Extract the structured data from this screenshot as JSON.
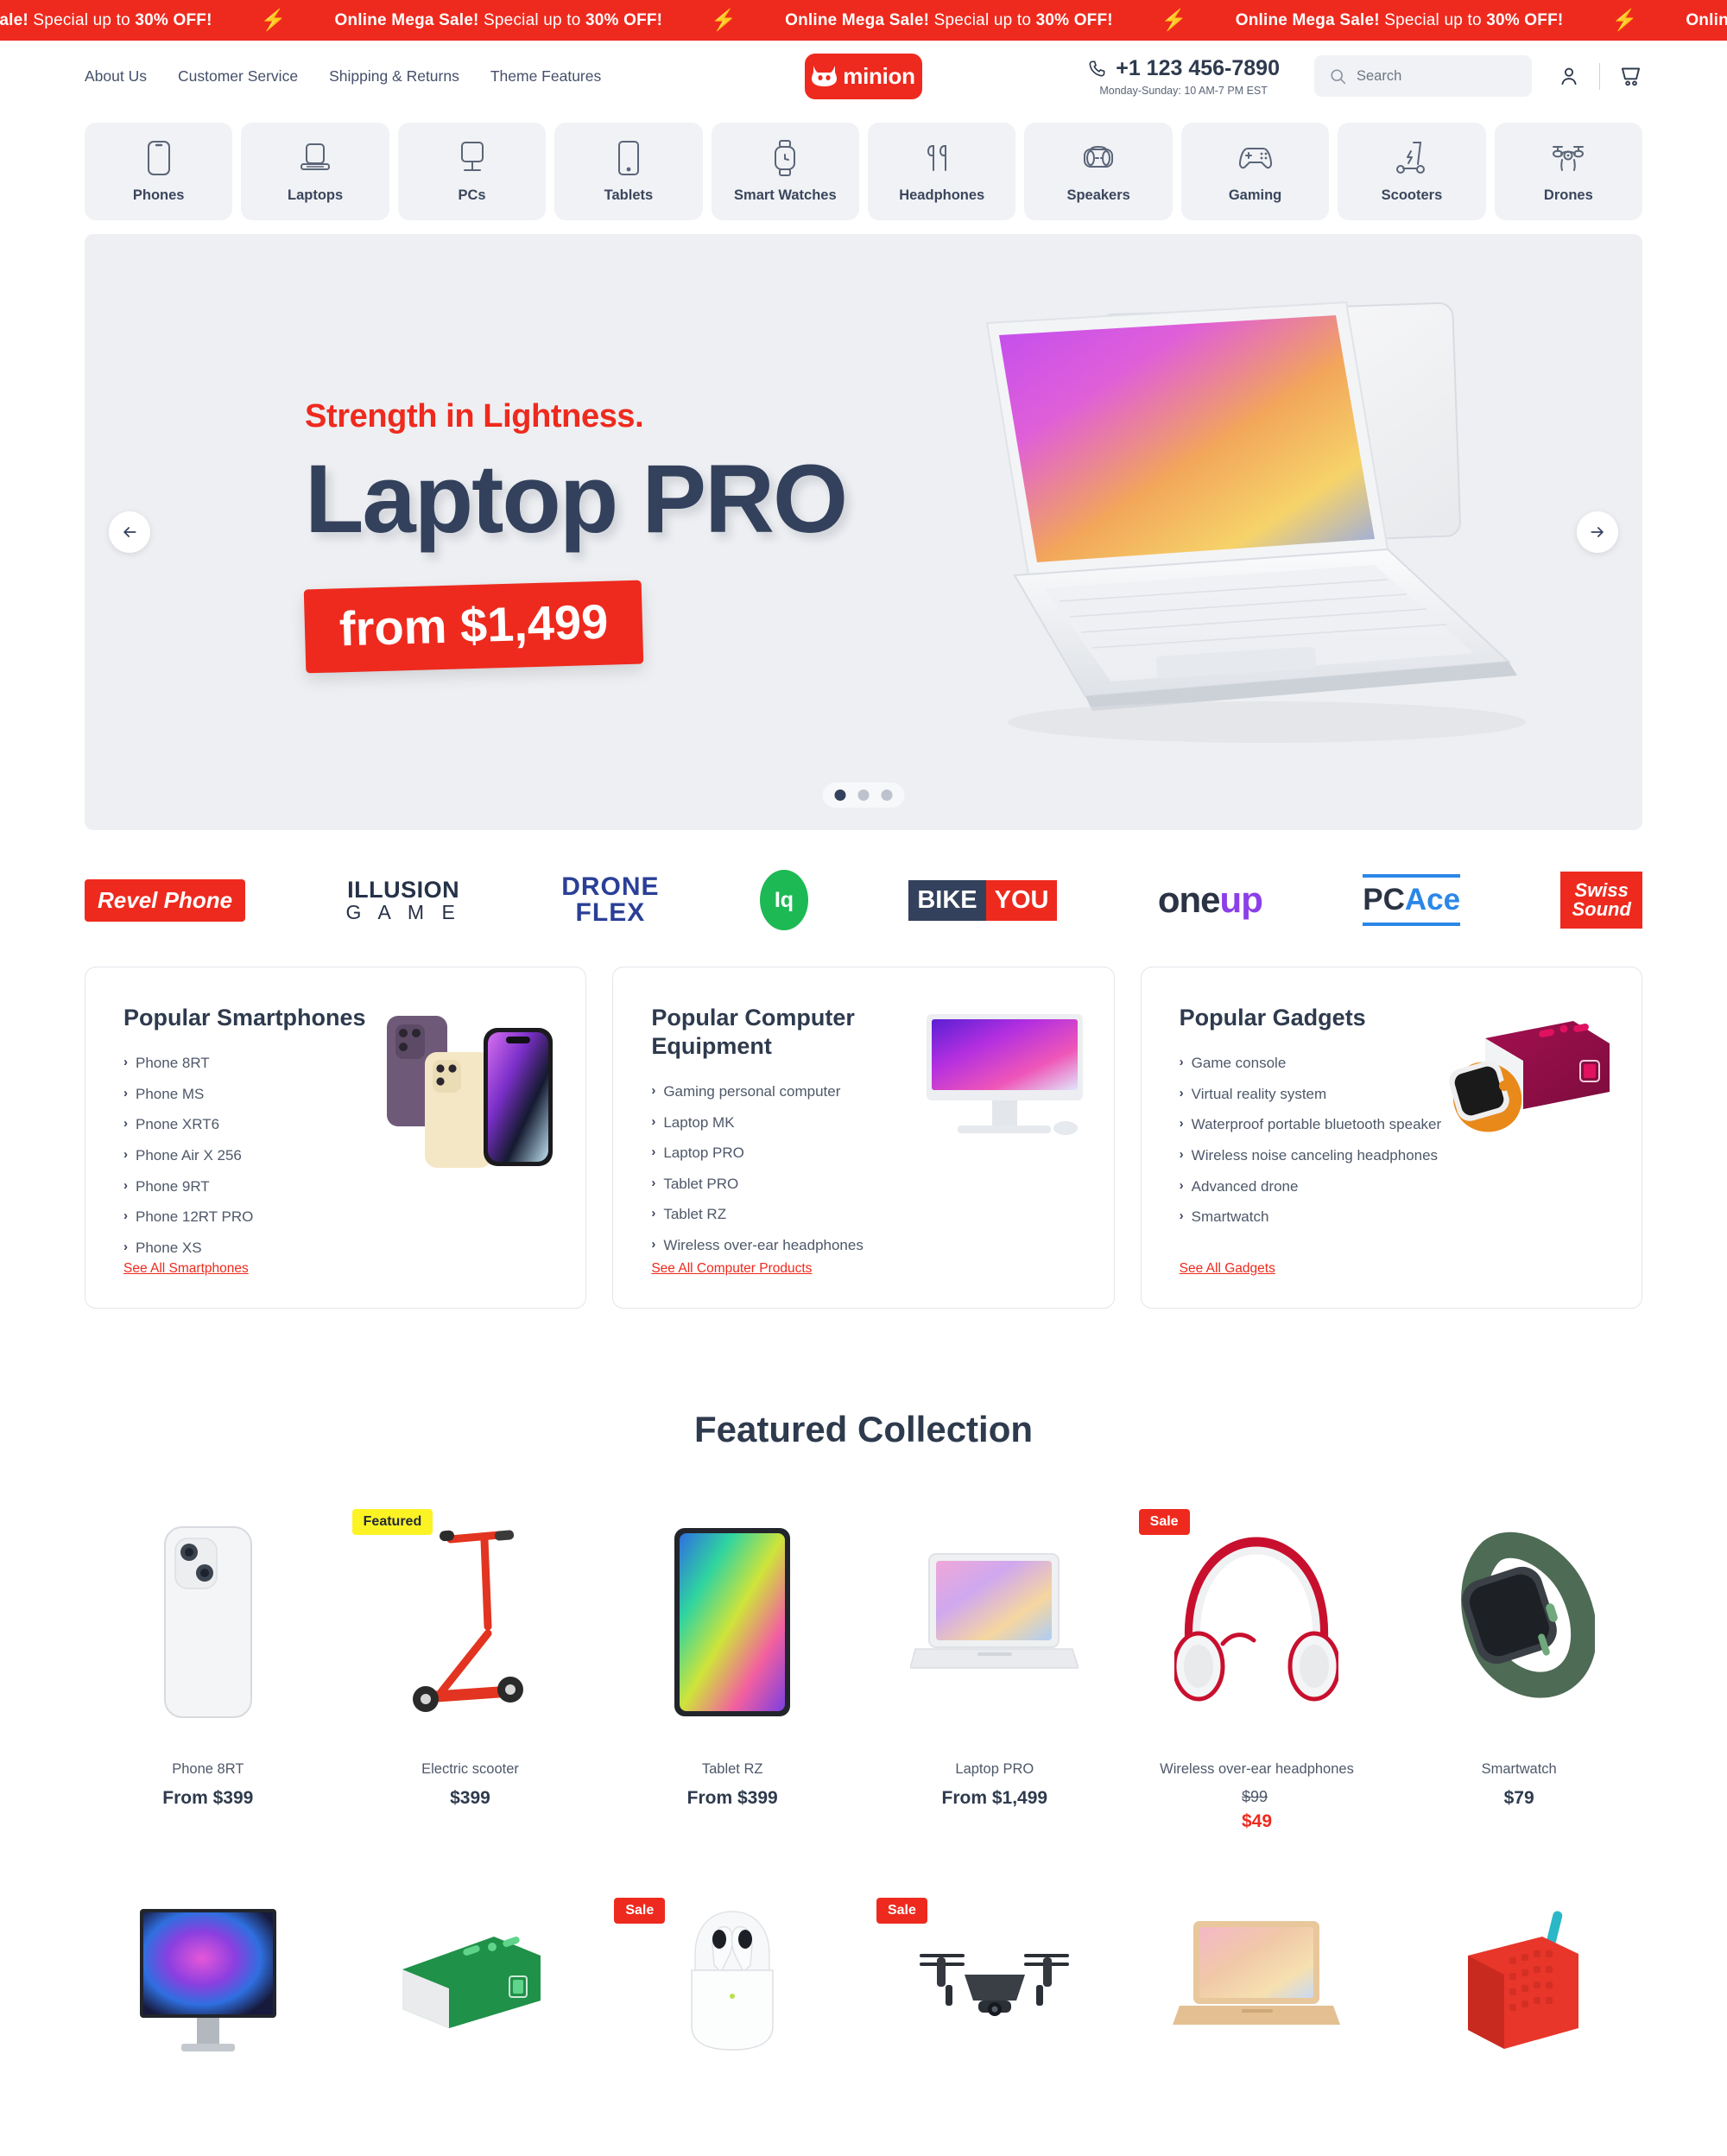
{
  "announcement": {
    "bolt_icon": "lightning-bolt-icon",
    "strong": "Online Mega Sale!",
    "rest": " Special up to ",
    "highlight": "30% OFF!",
    "repeat": 4
  },
  "header": {
    "topnav": [
      {
        "label": "About Us"
      },
      {
        "label": "Customer Service"
      },
      {
        "label": "Shipping & Returns"
      },
      {
        "label": "Theme Features"
      }
    ],
    "logo": {
      "wordmark": "minion",
      "mark_icon": "cow-head-icon",
      "bg": "#ee2a1e"
    },
    "phone": {
      "number": "+1 123 456-7890",
      "hours": "Monday-Sunday: 10 AM-7 PM EST",
      "icon": "phone-icon"
    },
    "search": {
      "placeholder": "Search",
      "icon": "search-icon"
    },
    "account_icon": "user-account-icon",
    "cart_icon": "shopping-cart-icon"
  },
  "categories": [
    {
      "label": "Phones",
      "icon": "phone-device-icon"
    },
    {
      "label": "Laptops",
      "icon": "laptop-icon"
    },
    {
      "label": "PCs",
      "icon": "desktop-monitor-icon"
    },
    {
      "label": "Tablets",
      "icon": "tablet-icon"
    },
    {
      "label": "Smart Watches",
      "icon": "smartwatch-icon"
    },
    {
      "label": "Headphones",
      "icon": "earbuds-icon"
    },
    {
      "label": "Speakers",
      "icon": "speaker-icon"
    },
    {
      "label": "Gaming",
      "icon": "gamepad-icon"
    },
    {
      "label": "Scooters",
      "icon": "scooter-icon"
    },
    {
      "label": "Drones",
      "icon": "drone-icon"
    }
  ],
  "hero": {
    "eyebrow": "Strength in Lightness.",
    "title": "Laptop PRO",
    "price": "from $1,499",
    "prev_icon": "arrow-left-icon",
    "next_icon": "arrow-right-icon",
    "slides": 3,
    "active_slide": 1,
    "accent": "#ee2a1e",
    "title_color": "#33415c"
  },
  "brands": [
    {
      "name": "Revel Phone"
    },
    {
      "name": "ILLUSION",
      "line2": "G A M E"
    },
    {
      "name": "DRONE",
      "line2": "FLEX"
    },
    {
      "name": "Iq"
    },
    {
      "name": "BIKE",
      "line2": "YOU"
    },
    {
      "name": "one",
      "line2": "up"
    },
    {
      "name": "PC",
      "line2": "Ace"
    },
    {
      "name": "Swiss",
      "line2": "Sound"
    }
  ],
  "popular": [
    {
      "title": "Popular Smartphones",
      "items": [
        "Phone 8RT",
        "Phone MS",
        "Pnone XRT6",
        "Phone Air X 256",
        "Phone 9RT",
        "Phone 12RT PRO",
        "Phone XS"
      ],
      "see_all": "See All Smartphones",
      "art": "smartphones-image"
    },
    {
      "title": "Popular Computer Equipment",
      "items": [
        "Gaming personal computer",
        "Laptop MK",
        "Laptop PRO",
        "Tablet PRO",
        "Tablet RZ",
        "Wireless over-ear headphones"
      ],
      "see_all": "See All Computer Products",
      "art": "desktop-computer-image"
    },
    {
      "title": "Popular Gadgets",
      "items": [
        "Game console",
        "Virtual reality system",
        "Waterproof portable bluetooth speaker",
        "Wireless noise canceling headphones",
        "Advanced drone",
        "Smartwatch"
      ],
      "see_all": "See All Gadgets",
      "art": "speaker-and-watch-image"
    }
  ],
  "featured": {
    "heading": "Featured Collection",
    "row1": [
      {
        "name": "Phone 8RT",
        "price": "From $399",
        "badge": null,
        "art": "phone-back-image"
      },
      {
        "name": "Electric scooter",
        "price": "$399",
        "badge": "Featured",
        "badge_type": "featured",
        "art": "red-scooter-image"
      },
      {
        "name": "Tablet RZ",
        "price": "From $399",
        "badge": null,
        "art": "tablet-image"
      },
      {
        "name": "Laptop PRO",
        "price": "From $1,499",
        "badge": null,
        "art": "laptop-image"
      },
      {
        "name": "Wireless over-ear headphones",
        "price_was": "$99",
        "price_now": "$49",
        "badge": "Sale",
        "badge_type": "sale",
        "art": "headphones-image"
      },
      {
        "name": "Smartwatch",
        "price": "$79",
        "badge": null,
        "art": "smartwatch-green-image"
      }
    ],
    "row2": [
      {
        "badge": null,
        "art": "monitor-image"
      },
      {
        "badge": null,
        "art": "green-speaker-image"
      },
      {
        "badge": "Sale",
        "badge_type": "sale",
        "art": "earbuds-case-image"
      },
      {
        "badge": "Sale",
        "badge_type": "sale",
        "art": "drone-image"
      },
      {
        "badge": null,
        "art": "gold-laptop-image"
      },
      {
        "badge": null,
        "art": "red-speaker-image"
      }
    ]
  }
}
